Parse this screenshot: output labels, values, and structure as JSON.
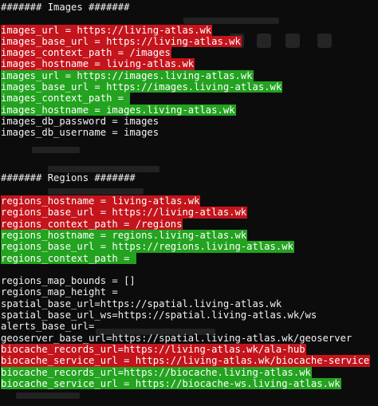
{
  "lines": [
    {
      "text": "####### Images #######",
      "style": "plain"
    },
    {
      "text": "",
      "style": "blank"
    },
    {
      "text": "images_url = https://living-atlas.wk",
      "style": "red"
    },
    {
      "text": "images_base_url = https://living-atlas.wk",
      "style": "red"
    },
    {
      "text": "images_context_path = /images",
      "style": "red"
    },
    {
      "text": "images_hostname = living-atlas.wk",
      "style": "red"
    },
    {
      "text": "images_url = https://images.living-atlas.wk",
      "style": "green"
    },
    {
      "text": "images_base_url = https://images.living-atlas.wk",
      "style": "green"
    },
    {
      "text": "images_context_path = ",
      "style": "green"
    },
    {
      "text": "images_hostname = images.living-atlas.wk",
      "style": "green"
    },
    {
      "text": "images_db_password = images",
      "style": "plain"
    },
    {
      "text": "images_db_username = images",
      "style": "plain"
    },
    {
      "text": "",
      "style": "blank"
    },
    {
      "text": "",
      "style": "blank"
    },
    {
      "text": "",
      "style": "blank"
    },
    {
      "text": "####### Regions #######",
      "style": "plain"
    },
    {
      "text": "",
      "style": "blank"
    },
    {
      "text": "regions_hostname = living-atlas.wk",
      "style": "red"
    },
    {
      "text": "regions_base_url = https://living-atlas.wk",
      "style": "red"
    },
    {
      "text": "regions_context_path = /regions",
      "style": "red"
    },
    {
      "text": "regions_hostname = regions.living-atlas.wk",
      "style": "green"
    },
    {
      "text": "regions_base_url = https://regions.living-atlas.wk",
      "style": "green"
    },
    {
      "text": "regions_context_path = ",
      "style": "green"
    },
    {
      "text": "",
      "style": "blank"
    },
    {
      "text": "regions_map_bounds = []",
      "style": "plain"
    },
    {
      "text": "regions_map_height = ",
      "style": "plain"
    },
    {
      "text": "spatial_base_url=https://spatial.living-atlas.wk",
      "style": "plain"
    },
    {
      "text": "spatial_base_url_ws=https://spatial.living-atlas.wk/ws",
      "style": "plain"
    },
    {
      "text": "alerts_base_url=",
      "style": "plain"
    },
    {
      "text": "geoserver_base_url=https://spatial.living-atlas.wk/geoserver",
      "style": "plain"
    },
    {
      "text": "biocache_records_url=https://living-atlas.wk/ala-hub",
      "style": "red"
    },
    {
      "text": "biocache_service_url = https://living-atlas.wk/biocache-service",
      "style": "red"
    },
    {
      "text": "biocache_records_url=https://biocache.living-atlas.wk",
      "style": "green"
    },
    {
      "text": "biocache_service_url = https://biocache-ws.living-atlas.wk",
      "style": "green"
    }
  ],
  "colors": {
    "background": "#0c0c0c",
    "removed_highlight": "#c4141c",
    "added_highlight": "#23a320",
    "text": "#f2f2f2"
  }
}
